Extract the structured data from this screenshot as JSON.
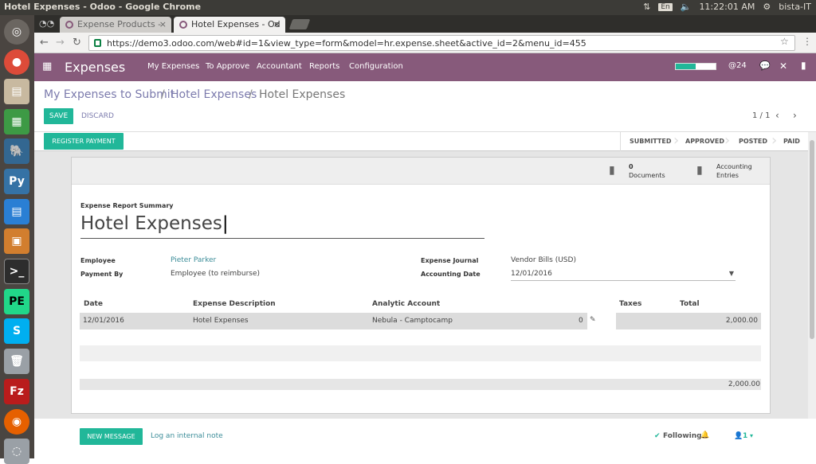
{
  "window": {
    "title": "Hotel Expenses - Odoo - Google Chrome",
    "lang": "En",
    "time": "11:22:01 AM",
    "user": "bista-IT"
  },
  "tabs": [
    {
      "label": "Expense Products -"
    },
    {
      "label": "Hotel Expenses - Od"
    }
  ],
  "address": {
    "url": "https://demo3.odoo.com/web#id=1&view_type=form&model=hr.expense.sheet&active_id=2&menu_id=455"
  },
  "app": {
    "name": "Expenses",
    "menu": [
      "My Expenses",
      "To Approve",
      "Accountant",
      "Reports",
      "Configuration"
    ],
    "messages_count": "24"
  },
  "breadcrumb": {
    "items": [
      "My Expenses to Submit",
      "Hotel Expenses"
    ],
    "current": "Hotel Expenses",
    "sep": "/"
  },
  "buttons": {
    "save": "SAVE",
    "discard": "DISCARD",
    "register_payment": "REGISTER PAYMENT",
    "new_message": "NEW MESSAGE",
    "log_note": "Log an internal note",
    "following": "Following",
    "followers": "1"
  },
  "pager": {
    "value": "1 / 1"
  },
  "statusbar": [
    "SUBMITTED",
    "APPROVED",
    "POSTED",
    "PAID"
  ],
  "smart_buttons": {
    "documents_count": "0",
    "documents_label": "Documents",
    "accounting_line1": "Accounting",
    "accounting_line2": "Entries"
  },
  "form": {
    "summary_label": "Expense Report Summary",
    "summary_value": "Hotel Expenses",
    "employee_label": "Employee",
    "employee_value": "Pieter Parker",
    "payment_label": "Payment By",
    "payment_value": "Employee (to reimburse)",
    "journal_label": "Expense Journal",
    "journal_value": "Vendor Bills (USD)",
    "acc_date_label": "Accounting Date",
    "acc_date_value": "12/01/2016"
  },
  "table": {
    "headers": [
      "Date",
      "Expense Description",
      "Analytic Account",
      "Taxes",
      "Total"
    ],
    "row": {
      "date": "12/01/2016",
      "description": "Hotel Expenses",
      "analytic": "Nebula - Camptocamp",
      "qty": "0",
      "total": "2,000.00"
    },
    "footer_total": "2,000.00"
  },
  "colors": {
    "brand": "#875a7b",
    "primary": "#21b799"
  }
}
